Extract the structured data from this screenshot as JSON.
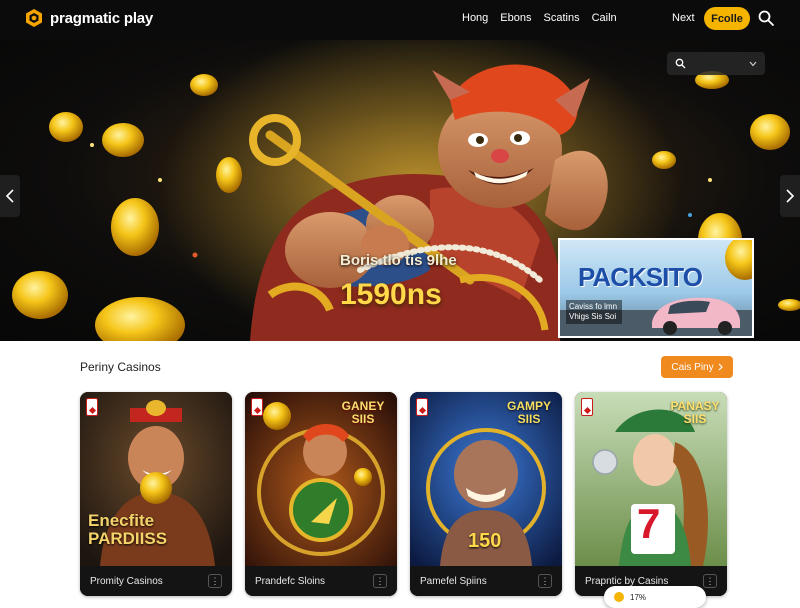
{
  "header": {
    "logo_text": "pragmatic play",
    "nav": [
      "Hong",
      "Ebons",
      "Scatins",
      "Cailn"
    ],
    "next_label": "Next",
    "cta_label": "Fcolle"
  },
  "hero": {
    "title": "Boris tlo tis 9lhe",
    "amount": "1590ns",
    "promo": {
      "title": "PACKSITO",
      "subtitle": "Caviss fo lmn Vhigs Sis Soi"
    },
    "colors": {
      "gold": "#f5c518",
      "glow": "#ffcf3a"
    }
  },
  "section": {
    "title": "Periny Casinos",
    "button_label": "Cais Piny"
  },
  "cards": [
    {
      "name": "Promity Casinos",
      "art_label": "Enecfite PARDIISS"
    },
    {
      "name": "Prandefc Sloins",
      "art_label": "GANEY SIIS"
    },
    {
      "name": "Pamefel Spiins",
      "art_label": "GAMPY SIIS",
      "art_number": "150"
    },
    {
      "name": "Prapntic by Casins",
      "art_label": "PANASY SIIS",
      "art_number": "7"
    }
  ],
  "floating": {
    "label": "17%"
  },
  "icons": {
    "logo": "cube-logo-icon",
    "search": "search-icon",
    "arrow_left": "chevron-left-icon",
    "arrow_right": "chevron-right-icon",
    "card_menu": "more-vertical-icon"
  },
  "colors": {
    "accent": "#f5b400",
    "section_button": "#f08a1e",
    "header_bg": "#0b0b0c"
  }
}
